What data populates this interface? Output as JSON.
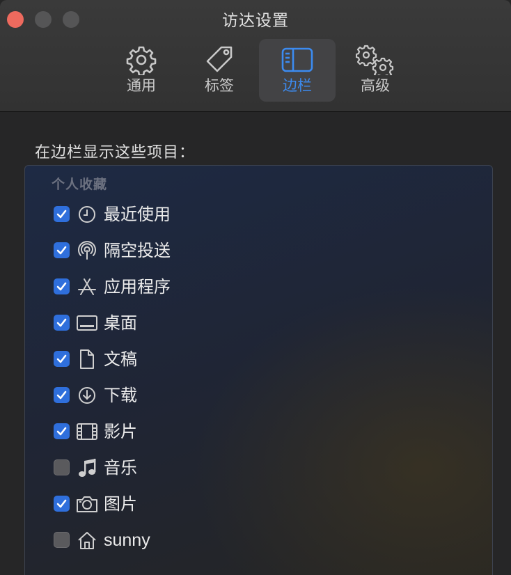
{
  "window": {
    "title": "访达设置"
  },
  "toolbar": {
    "tabs": [
      {
        "id": "general",
        "label": "通用",
        "icon": "gear-icon"
      },
      {
        "id": "tags",
        "label": "标签",
        "icon": "tag-icon"
      },
      {
        "id": "sidebar",
        "label": "边栏",
        "icon": "sidebar-icon",
        "selected": true
      },
      {
        "id": "advanced",
        "label": "高级",
        "icon": "gears-icon"
      }
    ]
  },
  "content": {
    "heading": "在边栏显示这些项目：",
    "group_label": "个人收藏",
    "items": [
      {
        "label": "最近使用",
        "icon": "clock-icon",
        "checked": true
      },
      {
        "label": "隔空投送",
        "icon": "airdrop-icon",
        "checked": true
      },
      {
        "label": "应用程序",
        "icon": "applications-icon",
        "checked": true
      },
      {
        "label": "桌面",
        "icon": "desktop-icon",
        "checked": true
      },
      {
        "label": "文稿",
        "icon": "document-icon",
        "checked": true
      },
      {
        "label": "下载",
        "icon": "download-icon",
        "checked": true
      },
      {
        "label": "影片",
        "icon": "film-icon",
        "checked": true
      },
      {
        "label": "音乐",
        "icon": "music-note-icon",
        "checked": false
      },
      {
        "label": "图片",
        "icon": "camera-icon",
        "checked": true
      },
      {
        "label": "sunny",
        "icon": "home-icon",
        "checked": false
      }
    ]
  },
  "colors": {
    "accent": "#3c8bf0",
    "checkbox_on": "#2f6fdc",
    "close_button": "#ed6a5e"
  }
}
